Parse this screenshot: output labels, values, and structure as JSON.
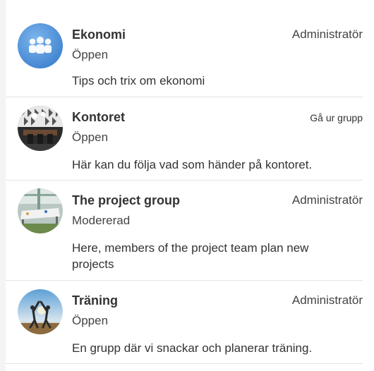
{
  "groups": [
    {
      "name": "Ekonomi",
      "role": "Administratör",
      "status": "Öppen",
      "description": "Tips och trix om ekonomi",
      "avatar_icon": "people-group-icon",
      "avatar_color": "#4a90d9"
    },
    {
      "name": "Kontoret",
      "role": "Gå ur grupp",
      "status": "Öppen",
      "description": "Här kan du följa vad som händer på kontoret.",
      "avatar_icon": "office-photo"
    },
    {
      "name": "The project group",
      "role": "Administratör",
      "status": "Modererad",
      "description": "Here, members of the project team plan new projects",
      "avatar_icon": "project-meeting-photo"
    },
    {
      "name": "Träning",
      "role": "Administratör",
      "status": "Öppen",
      "description": "En grupp där vi snackar och planerar träning.",
      "avatar_icon": "training-photo"
    }
  ]
}
